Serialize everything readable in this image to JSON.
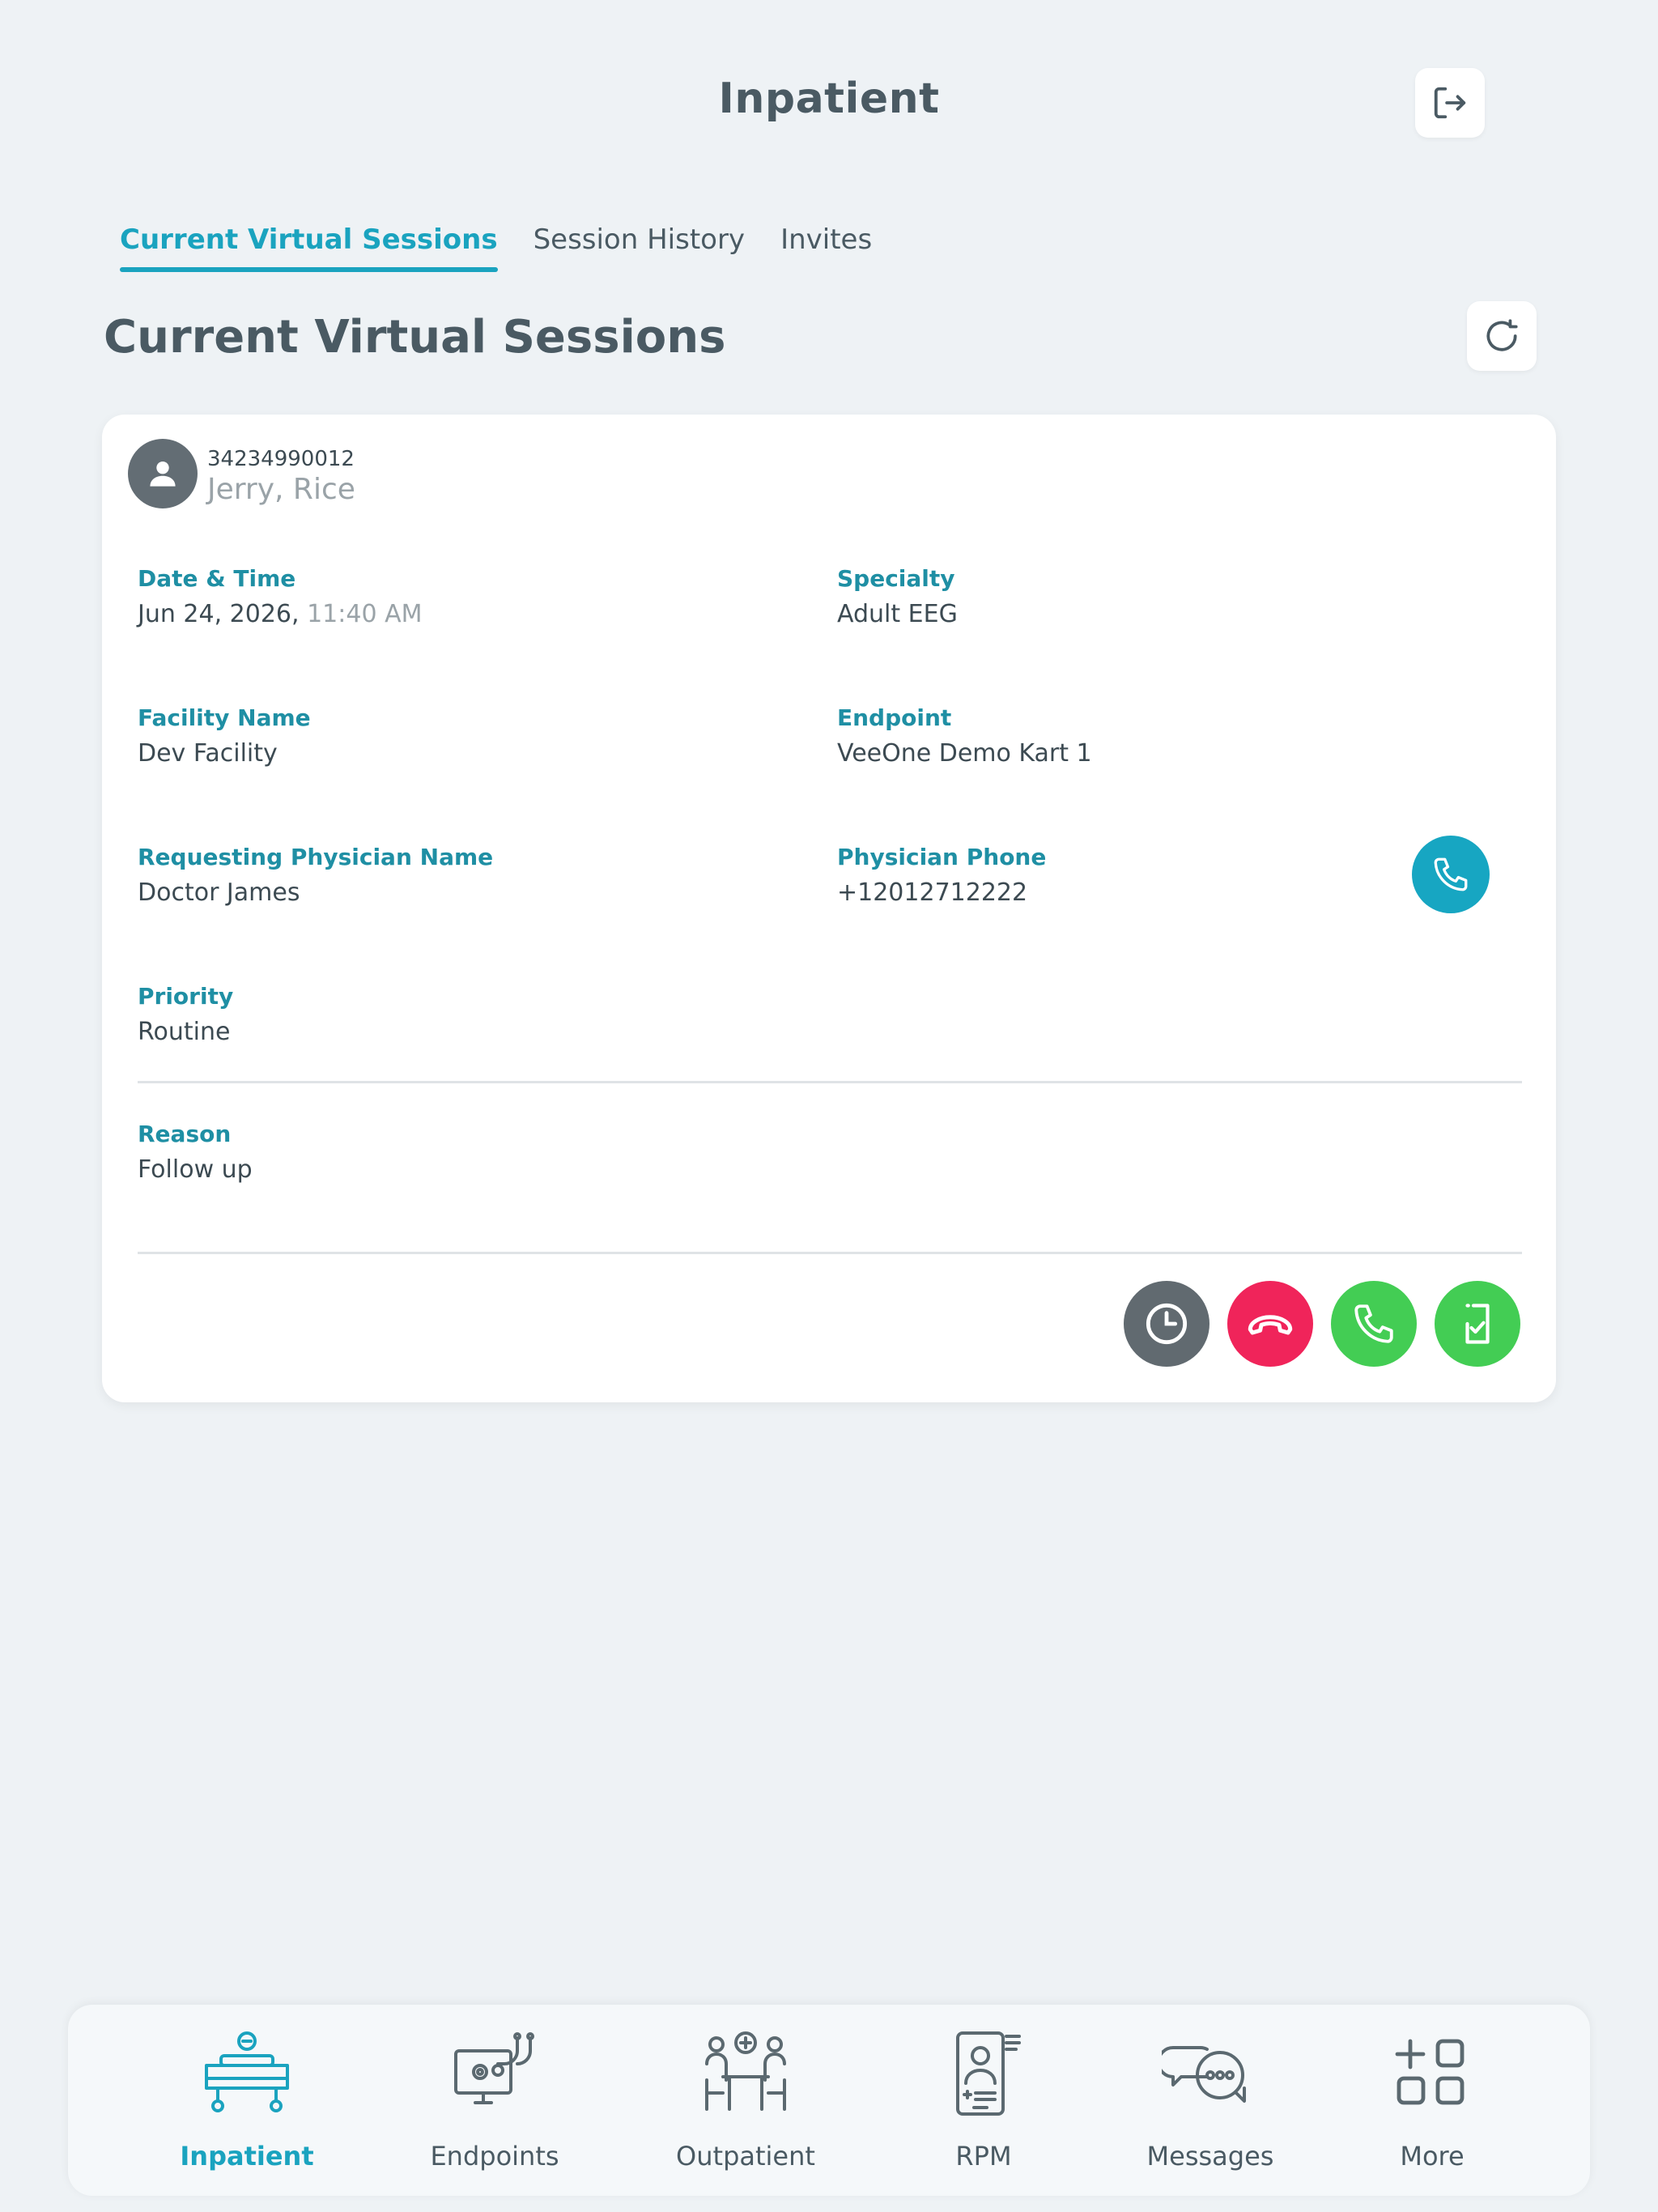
{
  "header": {
    "title": "Inpatient"
  },
  "tabs": [
    {
      "label": "Current Virtual Sessions",
      "active": true
    },
    {
      "label": "Session History",
      "active": false
    },
    {
      "label": "Invites",
      "active": false
    }
  ],
  "section_title": "Current Virtual Sessions",
  "session": {
    "patient_id": "34234990012",
    "patient_name": "Jerry, Rice",
    "fields": {
      "datetime": {
        "label": "Date & Time",
        "date": "Jun 24, 2026,",
        "time": "11:40 AM"
      },
      "specialty": {
        "label": "Specialty",
        "value": "Adult EEG"
      },
      "facility": {
        "label": "Facility Name",
        "value": "Dev Facility"
      },
      "endpoint": {
        "label": "Endpoint",
        "value": "VeeOne Demo Kart 1"
      },
      "physician": {
        "label": "Requesting Physician Name",
        "value": "Doctor James"
      },
      "phone": {
        "label": "Physician Phone",
        "value": "+12012712222"
      },
      "priority": {
        "label": "Priority",
        "value": "Routine"
      },
      "reason": {
        "label": "Reason",
        "value": "Follow up"
      }
    }
  },
  "bottom_nav": [
    {
      "label": "Inpatient",
      "icon": "hospital-bed-icon",
      "active": true
    },
    {
      "label": "Endpoints",
      "icon": "monitor-stethoscope-icon",
      "active": false
    },
    {
      "label": "Outpatient",
      "icon": "consultation-icon",
      "active": false
    },
    {
      "label": "RPM",
      "icon": "tablet-doctor-icon",
      "active": false
    },
    {
      "label": "Messages",
      "icon": "chat-bubbles-icon",
      "active": false
    },
    {
      "label": "More",
      "icon": "grid-plus-icon",
      "active": false
    }
  ],
  "colors": {
    "accent": "#1aa3bf",
    "decline": "#f0245a",
    "accept": "#43cd54",
    "neutral": "#616a70"
  }
}
